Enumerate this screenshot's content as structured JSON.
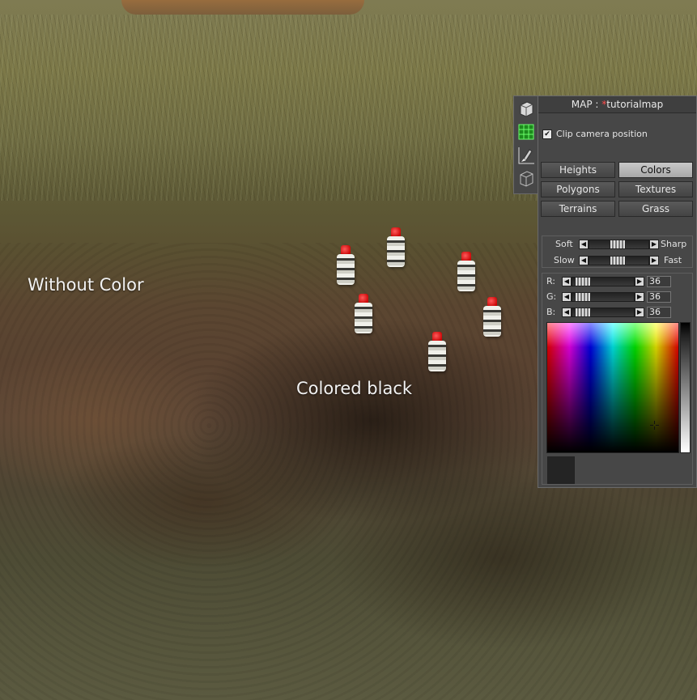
{
  "scene": {
    "label_without_color": "Without Color",
    "label_colored_black": "Colored black"
  },
  "panel": {
    "title_prefix": "MAP : ",
    "title_star": "*",
    "title_name": "tutorialmap",
    "clip_camera_label": "Clip camera position",
    "clip_camera_checked": true,
    "modes": [
      {
        "label": "Heights",
        "active": false
      },
      {
        "label": "Colors",
        "active": true
      },
      {
        "label": "Polygons",
        "active": false
      },
      {
        "label": "Textures",
        "active": false
      },
      {
        "label": "Terrains",
        "active": false
      },
      {
        "label": "Grass",
        "active": false
      }
    ],
    "brush": {
      "soft_label": "Soft",
      "sharp_label": "Sharp",
      "slow_label": "Slow",
      "fast_label": "Fast"
    },
    "rgb": {
      "r_label": "R:",
      "g_label": "G:",
      "b_label": "B:",
      "r": "36",
      "g": "36",
      "b": "36"
    },
    "swatch_color": "#242424",
    "side_tabs": [
      "cube-tab-icon",
      "grid-tab-icon",
      "paint-brush-tab-icon",
      "wireframe-cube-tab-icon"
    ]
  }
}
